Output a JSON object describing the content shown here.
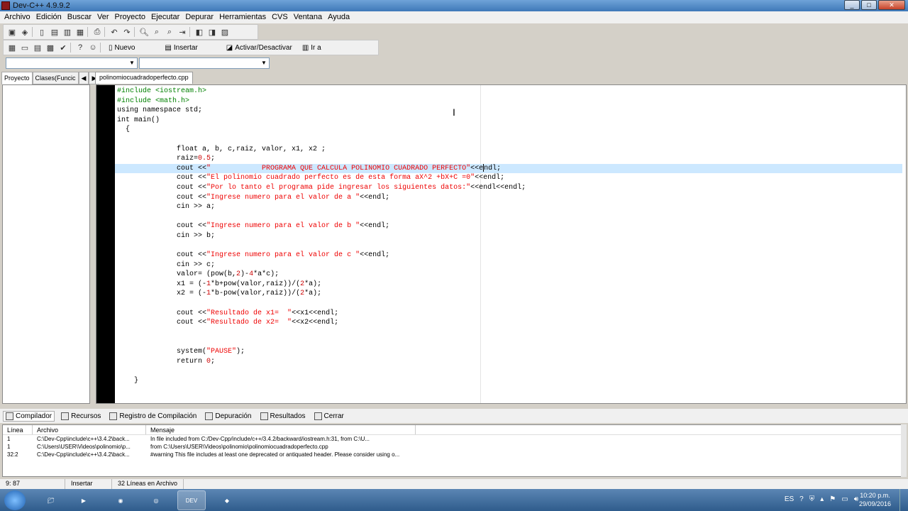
{
  "window": {
    "title": "Dev-C++ 4.9.9.2",
    "minimize": "_",
    "maximize": "□",
    "close": "✕"
  },
  "menu": [
    "Archivo",
    "Edición",
    "Buscar",
    "Ver",
    "Proyecto",
    "Ejecutar",
    "Depurar",
    "Herramientas",
    "CVS",
    "Ventana",
    "Ayuda"
  ],
  "toolbar2": {
    "new_label": "Nuevo",
    "insert_label": "Insertar",
    "toggle_label": "Activar/Desactivar",
    "goto_label": "Ir a"
  },
  "left_tabs": {
    "project": "Proyecto",
    "classes": "Clases(Funcic"
  },
  "file_tab": "polinomiocuadradoperfecto.cpp",
  "code_lines": [
    [
      {
        "c": "pp",
        "t": "#include <iostream.h>"
      }
    ],
    [
      {
        "c": "pp",
        "t": "#include <math.h>"
      }
    ],
    [
      {
        "c": "",
        "t": "using namespace std;"
      }
    ],
    [
      {
        "c": "",
        "t": "int main()"
      }
    ],
    [
      {
        "c": "",
        "t": "  {"
      }
    ],
    [
      {
        "c": "",
        "t": ""
      }
    ],
    [
      {
        "c": "",
        "t": "              float a, b, c,raiz, valor, x1, x2 ;"
      }
    ],
    [
      {
        "c": "",
        "t": "              raiz="
      },
      {
        "c": "num",
        "t": "0.5"
      },
      {
        "c": "",
        "t": ";"
      }
    ],
    [
      {
        "c": "",
        "t": "              cout <<"
      },
      {
        "c": "str",
        "t": "\"            PROGRAMA QUE CALCULA POLINOMIO CUADRADO PERFECTO\""
      },
      {
        "c": "",
        "t": "<<e"
      },
      {
        "c": "caret",
        "t": ""
      },
      {
        "c": "",
        "t": "ndl;"
      }
    ],
    [
      {
        "c": "",
        "t": "              cout <<"
      },
      {
        "c": "str",
        "t": "\"El polinomio cuadrado perfecto es de esta forma aX^2 +bX+C =0\""
      },
      {
        "c": "",
        "t": "<<endl;"
      }
    ],
    [
      {
        "c": "",
        "t": "              cout <<"
      },
      {
        "c": "str",
        "t": "\"Por lo tanto el programa pide ingresar los siguientes datos:\""
      },
      {
        "c": "",
        "t": "<<endl<<endl;"
      }
    ],
    [
      {
        "c": "",
        "t": "              cout <<"
      },
      {
        "c": "str",
        "t": "\"Ingrese numero para el valor de a \""
      },
      {
        "c": "",
        "t": "<<endl;"
      }
    ],
    [
      {
        "c": "",
        "t": "              cin >> a;"
      }
    ],
    [
      {
        "c": "",
        "t": ""
      }
    ],
    [
      {
        "c": "",
        "t": "              cout <<"
      },
      {
        "c": "str",
        "t": "\"Ingrese numero para el valor de b \""
      },
      {
        "c": "",
        "t": "<<endl;"
      }
    ],
    [
      {
        "c": "",
        "t": "              cin >> b;"
      }
    ],
    [
      {
        "c": "",
        "t": ""
      }
    ],
    [
      {
        "c": "",
        "t": "              cout <<"
      },
      {
        "c": "str",
        "t": "\"Ingrese numero para el valor de c \""
      },
      {
        "c": "",
        "t": "<<endl;"
      }
    ],
    [
      {
        "c": "",
        "t": "              cin >> c;"
      }
    ],
    [
      {
        "c": "",
        "t": "              valor= (pow(b,"
      },
      {
        "c": "num",
        "t": "2"
      },
      {
        "c": "",
        "t": ")-"
      },
      {
        "c": "num",
        "t": "4"
      },
      {
        "c": "",
        "t": "*a*c);"
      }
    ],
    [
      {
        "c": "",
        "t": "              x1 = (-"
      },
      {
        "c": "num",
        "t": "1"
      },
      {
        "c": "",
        "t": "*b+pow(valor,raiz))/("
      },
      {
        "c": "num",
        "t": "2"
      },
      {
        "c": "",
        "t": "*a);"
      }
    ],
    [
      {
        "c": "",
        "t": "              x2 = (-"
      },
      {
        "c": "num",
        "t": "1"
      },
      {
        "c": "",
        "t": "*b-pow(valor,raiz))/("
      },
      {
        "c": "num",
        "t": "2"
      },
      {
        "c": "",
        "t": "*a);"
      }
    ],
    [
      {
        "c": "",
        "t": ""
      }
    ],
    [
      {
        "c": "",
        "t": "              cout <<"
      },
      {
        "c": "str",
        "t": "\"Resultado de x1=  \""
      },
      {
        "c": "",
        "t": "<<x1<<endl;"
      }
    ],
    [
      {
        "c": "",
        "t": "              cout <<"
      },
      {
        "c": "str",
        "t": "\"Resultado de x2=  \""
      },
      {
        "c": "",
        "t": "<<x2<<endl;"
      }
    ],
    [
      {
        "c": "",
        "t": ""
      }
    ],
    [
      {
        "c": "",
        "t": ""
      }
    ],
    [
      {
        "c": "",
        "t": "              system("
      },
      {
        "c": "str",
        "t": "\"PAUSE\""
      },
      {
        "c": "",
        "t": ");"
      }
    ],
    [
      {
        "c": "",
        "t": "              return "
      },
      {
        "c": "num",
        "t": "0"
      },
      {
        "c": "",
        "t": ";"
      }
    ],
    [
      {
        "c": "",
        "t": ""
      }
    ],
    [
      {
        "c": "",
        "t": "    }"
      }
    ]
  ],
  "highlighted_line": 8,
  "bottom_tabs": [
    "Compilador",
    "Recursos",
    "Registro de Compilación",
    "Depuración",
    "Resultados",
    "Cerrar"
  ],
  "results": {
    "headers": [
      "Línea",
      "Archivo",
      "Mensaje"
    ],
    "rows": [
      [
        "1",
        "C:\\Dev-Cpp\\include\\c++\\3.4.2\\back...",
        "In file included from C:/Dev-Cpp/include/c++/3.4.2/backward/iostream.h:31,                  from C:\\U..."
      ],
      [
        "1",
        "C:\\Users\\USER\\Videos\\polinomio\\p...",
        "                    from C:\\Users\\USER\\Videos\\polinomio\\polinomiocuadradoperfecto.cpp"
      ],
      [
        "32:2",
        "C:\\Dev-Cpp\\include\\c++\\3.4.2\\back...",
        "#warning This file includes at least one deprecated or antiquated header. Please consider using o..."
      ]
    ]
  },
  "status": {
    "position": "9: 87",
    "mode": "Insertar",
    "lines": "32 Líneas en Archivo"
  },
  "taskbar": {
    "lang": "ES",
    "time": "10:20 p.m.",
    "date": "29/09/2016",
    "devcpp": "DEV"
  }
}
